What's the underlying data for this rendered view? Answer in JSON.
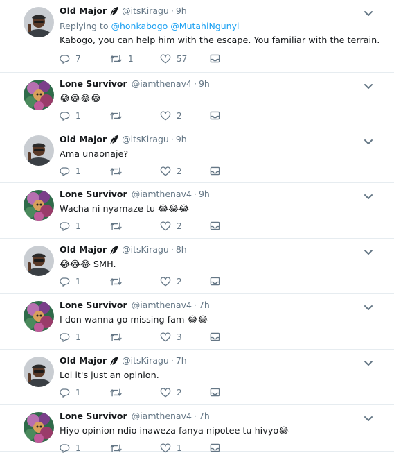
{
  "tweets": [
    {
      "author": "Old Major",
      "handle": "@itsKiragu",
      "time": "9h",
      "replying_prefix": "Replying to ",
      "replying_to": [
        "@honkabogo",
        "@MutahiNgunyi"
      ],
      "text": "Kabogo, you can help him with the escape. You familiar with the terrain.",
      "counts": {
        "reply": "7",
        "retweet": "1",
        "like": "57"
      }
    },
    {
      "author": "Lone Survivor",
      "handle": "@iamthenav4",
      "time": "9h",
      "text": "😂😂😂😂",
      "counts": {
        "reply": "1",
        "retweet": "",
        "like": "2"
      }
    },
    {
      "author": "Old Major",
      "handle": "@itsKiragu",
      "time": "9h",
      "text": "Ama unaonaje?",
      "counts": {
        "reply": "1",
        "retweet": "",
        "like": "2"
      }
    },
    {
      "author": "Lone Survivor",
      "handle": "@iamthenav4",
      "time": "9h",
      "text": "Wacha ni nyamaze tu 😂😂😂",
      "counts": {
        "reply": "1",
        "retweet": "",
        "like": "2"
      }
    },
    {
      "author": "Old Major",
      "handle": "@itsKiragu",
      "time": "8h",
      "text": "😂😂😂 SMH.",
      "counts": {
        "reply": "1",
        "retweet": "",
        "like": "2"
      }
    },
    {
      "author": "Lone Survivor",
      "handle": "@iamthenav4",
      "time": "7h",
      "text": "I don wanna go missing fam 😂😂",
      "counts": {
        "reply": "1",
        "retweet": "",
        "like": "3"
      }
    },
    {
      "author": "Old Major",
      "handle": "@itsKiragu",
      "time": "7h",
      "text": "Lol it's just an opinion.",
      "counts": {
        "reply": "1",
        "retweet": "",
        "like": "2"
      }
    },
    {
      "author": "Lone Survivor",
      "handle": "@iamthenav4",
      "time": "7h",
      "text": "Hiyo opinion ndio inaweza fanya nipotee tu hivyo😂",
      "counts": {
        "reply": "1",
        "retweet": "",
        "like": "1"
      }
    }
  ],
  "separator": "·",
  "icons": {
    "reply": "reply-icon",
    "retweet": "retweet-icon",
    "like": "heart-icon",
    "dm": "direct-message-icon",
    "more": "chevron-down-icon",
    "feather": "feather-icon"
  },
  "colors": {
    "name": "#14171a",
    "meta": "#657786",
    "link": "#1da1f2",
    "divider": "#e6ecf0"
  }
}
